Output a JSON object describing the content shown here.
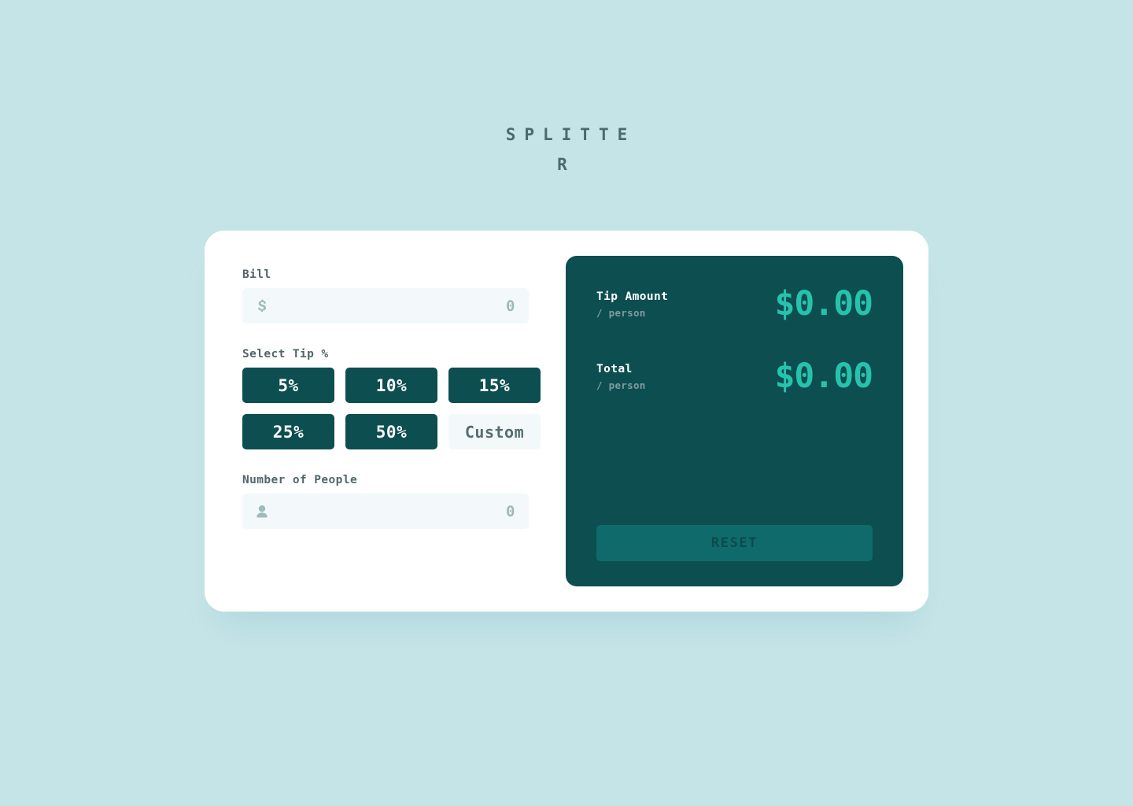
{
  "app": {
    "title": "SPLITTER"
  },
  "form": {
    "bill": {
      "label": "Bill",
      "icon": "dollar-icon",
      "value": "0",
      "placeholder": "0"
    },
    "tip": {
      "label": "Select Tip %",
      "options": [
        {
          "label": "5%",
          "selected": false
        },
        {
          "label": "10%",
          "selected": false
        },
        {
          "label": "15%",
          "selected": false
        },
        {
          "label": "25%",
          "selected": false
        },
        {
          "label": "50%",
          "selected": false
        },
        {
          "label": "Custom",
          "selected": false
        }
      ]
    },
    "people": {
      "label": "Number of People",
      "icon": "person-icon",
      "value": "0",
      "placeholder": "0"
    }
  },
  "results": {
    "tip_amount": {
      "title": "Tip Amount",
      "subtitle": "/ person",
      "amount": "$0.00"
    },
    "total": {
      "title": "Total",
      "subtitle": "/ person",
      "amount": "$0.00"
    },
    "reset_label": "RESET"
  },
  "colors": {
    "background": "#c5e4e7",
    "card": "#ffffff",
    "dark_panel": "#0d4e50",
    "accent_green": "#26c2ad",
    "input_bg": "#f3f8fa",
    "label_text": "#51656a",
    "muted_text": "#9fb8bb",
    "reset_bg": "#0f6b6b"
  }
}
